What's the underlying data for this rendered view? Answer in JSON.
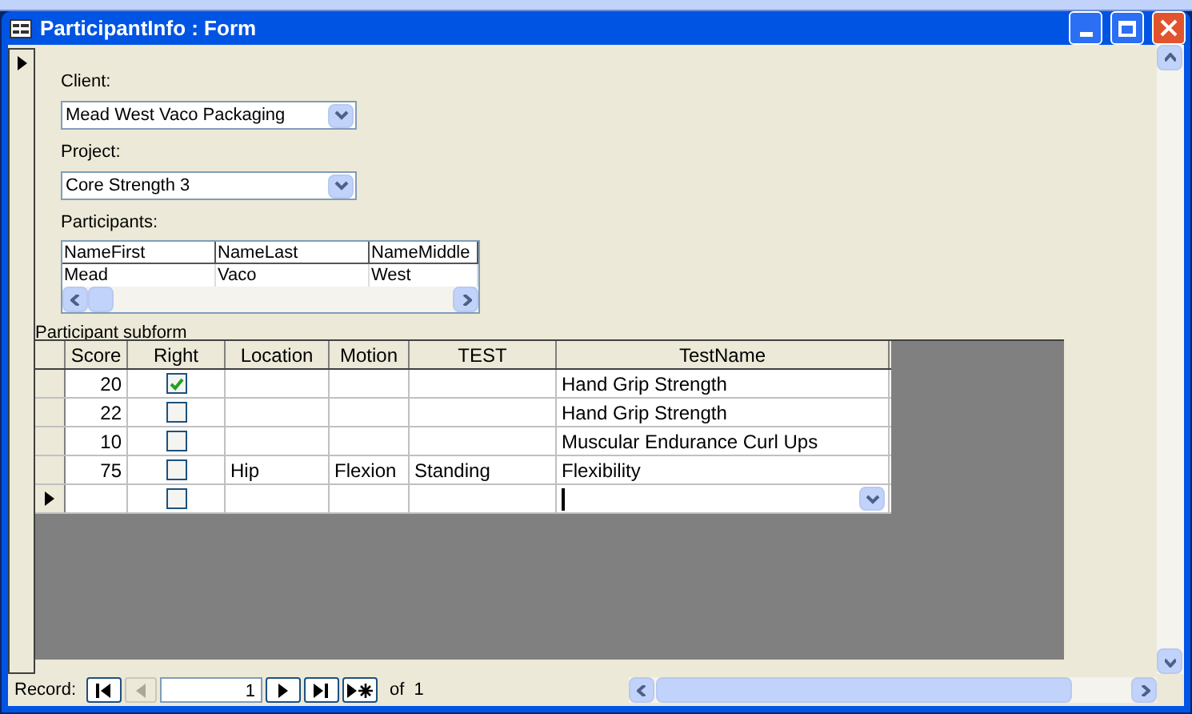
{
  "window": {
    "title": "ParticipantInfo : Form"
  },
  "client": {
    "label": "Client:",
    "value": "Mead West Vaco Packaging"
  },
  "project": {
    "label": "Project:",
    "value": "Core Strength 3"
  },
  "participants": {
    "label": "Participants:",
    "columns": [
      "NameFirst",
      "NameLast",
      "NameMiddle"
    ],
    "rows": [
      [
        "Mead",
        "Vaco",
        "West"
      ]
    ]
  },
  "subform": {
    "label": "Participant subform",
    "columns": [
      "Score",
      "Right",
      "Location",
      "Motion",
      "TEST",
      "TestName"
    ],
    "rows": [
      {
        "score": "20",
        "right": true,
        "location": "",
        "motion": "",
        "test": "",
        "test_name": "Hand Grip Strength",
        "current": false
      },
      {
        "score": "22",
        "right": false,
        "location": "",
        "motion": "",
        "test": "",
        "test_name": "Hand Grip Strength",
        "current": false
      },
      {
        "score": "10",
        "right": false,
        "location": "",
        "motion": "",
        "test": "",
        "test_name": "Muscular Endurance Curl Ups",
        "current": false
      },
      {
        "score": "75",
        "right": false,
        "location": "Hip",
        "motion": "Flexion",
        "test": "Standing",
        "test_name": "Flexibility",
        "current": false
      },
      {
        "score": "",
        "right": false,
        "location": "",
        "motion": "",
        "test": "",
        "test_name": "",
        "current": true
      }
    ]
  },
  "navigation": {
    "label": "Record:",
    "record": "1",
    "of": "of",
    "total": "1"
  }
}
